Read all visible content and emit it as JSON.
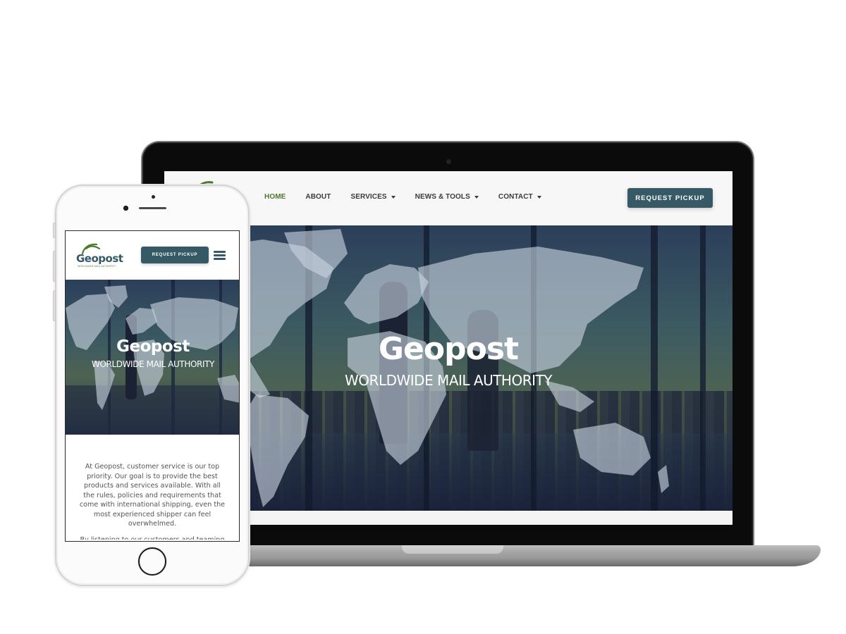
{
  "desktop": {
    "nav": {
      "items": [
        {
          "label": "HOME",
          "active": true,
          "has_dropdown": false
        },
        {
          "label": "ABOUT",
          "active": false,
          "has_dropdown": false
        },
        {
          "label": "SERVICES",
          "active": false,
          "has_dropdown": true
        },
        {
          "label": "NEWS & TOOLS",
          "active": false,
          "has_dropdown": true
        },
        {
          "label": "CONTACT",
          "active": false,
          "has_dropdown": true
        }
      ],
      "cta_label": "REQUEST PICKUP"
    },
    "hero": {
      "title": "Geopost",
      "subtitle": "WORLDWIDE MAIL AUTHORITY"
    }
  },
  "mobile": {
    "header": {
      "logo_text": "Geopost",
      "logo_tagline": "WORLDWIDE MAIL AUTHORITY",
      "cta_label": "REQUEST PICKUP",
      "menu_icon": "hamburger-icon"
    },
    "hero": {
      "title": "Geopost",
      "subtitle": "WORLDWIDE MAIL AUTHORITY"
    },
    "body": {
      "paragraphs": [
        "At Geopost, customer service is our top priority.  Our goal is to provide the best products and services available.  With all the rules, policies and requirements that come with international shipping, even the most experienced shipper can feel overwhelmed.",
        "By listening to our customers and teaming with them, we ensure that Geopost delivers"
      ]
    }
  },
  "colors": {
    "brand_teal": "#355a66",
    "brand_green": "#4a7a2c",
    "nav_text": "#3a3a3a"
  }
}
